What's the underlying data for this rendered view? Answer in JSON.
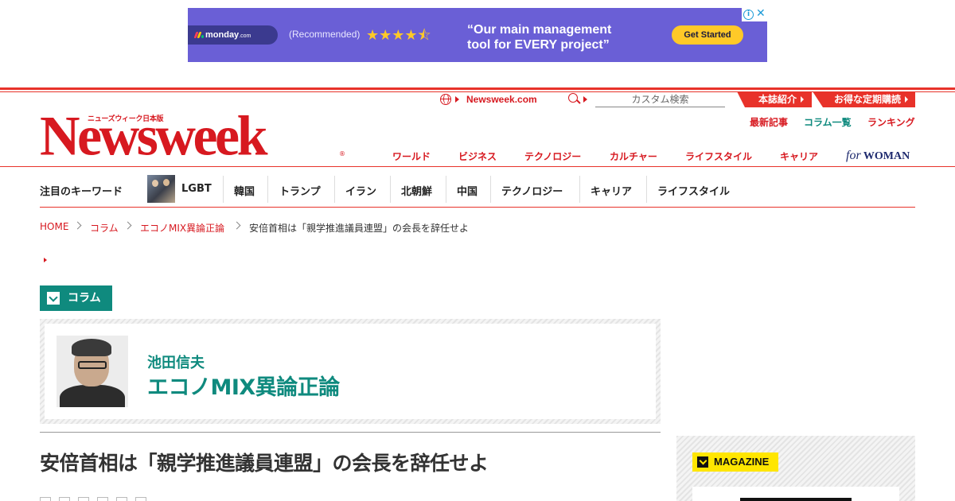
{
  "ad": {
    "brand": "monday",
    "brand_suffix": ".com",
    "recommended": "(Recommended)",
    "stars": "★★★★⯪",
    "headline_1": "“Our main management",
    "headline_2": "tool for EVERY project”",
    "cta": "Get Started",
    "colors": {
      "background": "#6a5fd6",
      "cta": "#ffc928"
    }
  },
  "header": {
    "logo_sub": "ニューズウィーク日本版",
    "logo": "Newsweek",
    "logo_reg": "®",
    "newsweek_com": "Newsweek.com",
    "search_placeholder": "カスタム検索",
    "tab_about": "本誌紹介",
    "tab_subscribe": "お得な定期購読",
    "sub_latest": "最新記事",
    "sub_columns": "コラム一覧",
    "sub_ranking": "ランキング",
    "colors": {
      "brand_red": "#d71920",
      "teal": "#0f8a7e"
    }
  },
  "main_nav": {
    "items": [
      "ワールド",
      "ビジネス",
      "テクノロジー",
      "カルチャー",
      "ライフスタイル",
      "キャリア"
    ],
    "for_woman_for": "for",
    "for_woman_woman": "WOMAN"
  },
  "keywords": {
    "title": "注目のキーワード",
    "items": [
      "LGBT",
      "韓国",
      "トランプ",
      "イラン",
      "北朝鮮",
      "中国",
      "テクノロジー",
      "キャリア",
      "ライフスタイル"
    ]
  },
  "breadcrumb": {
    "items": [
      "HOME",
      "コラム",
      "エコノMIX異論正論"
    ],
    "current": "安倍首相は「親学推進議員連盟」の会長を辞任せよ"
  },
  "column_label": "コラム",
  "author": {
    "name": "池田信夫",
    "column": "エコノMIX異論正論"
  },
  "article": {
    "title": "安倍首相は「親学推進議員連盟」の会長を辞任せよ"
  },
  "sidebar": {
    "magazine_label": "MAGAZINE"
  }
}
